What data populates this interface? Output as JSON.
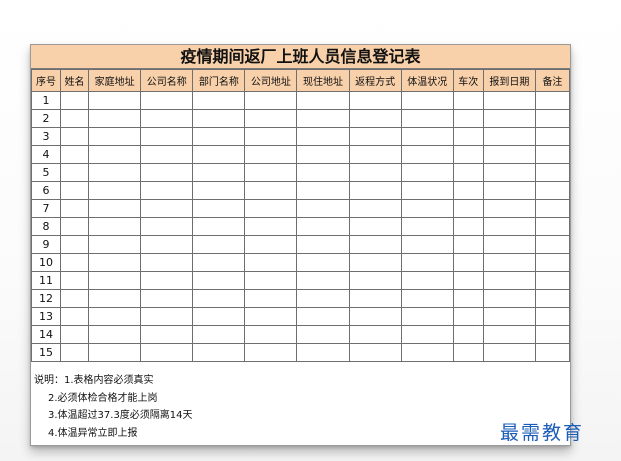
{
  "title": "疫情期间返厂上班人员信息登记表",
  "columns": [
    "序号",
    "姓名",
    "家庭地址",
    "公司名称",
    "部门名称",
    "公司地址",
    "现住地址",
    "返程方式",
    "体温状况",
    "车次",
    "报到日期",
    "备注"
  ],
  "rows": [
    "1",
    "2",
    "3",
    "4",
    "5",
    "6",
    "7",
    "8",
    "9",
    "10",
    "11",
    "12",
    "13",
    "14",
    "15"
  ],
  "notes": {
    "label": "说明：",
    "items": [
      "1.表格内容必须真实",
      "2.必须体检合格才能上岗",
      "3.体温超过37.3度必须隔离14天",
      "4.体温异常立即上报"
    ]
  },
  "watermark": "最需教育",
  "colors": {
    "header_fill": "#f8d0aa",
    "grid_line": "#6f6f6f",
    "watermark": "#1c5db8"
  }
}
